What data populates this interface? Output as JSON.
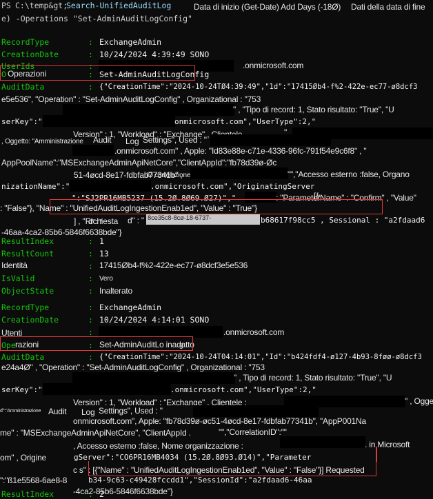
{
  "window": {
    "title": "Search-UnifiedAuditLog",
    "shell": "PowerShell",
    "background_color": "#0c0c0c",
    "label_color": "#16c60c",
    "text_color": "#cccccc",
    "annotation_color": "#e03a3a",
    "selection_background": "#c9c9c9"
  },
  "prompt": {
    "ps": "PS",
    "path": "C:\\temp&gt;",
    "command": "Search-UnifiedAuditLog",
    "continuation": "e) -Operations \"Set-AdminAuditLogConfig\""
  },
  "annotations": {
    "start_date": "Data di inizio (Get-Date) Add Days (-18Ø)",
    "end_date": "Dati della data di fine",
    "operations_label_1": "Operazioni",
    "operations_value_1": "Set-AdminAuditLogConfig",
    "operations_label_2": "Operazioni",
    "operations_value_2": "Set-AdminAuditLo inadatto",
    "operations_value_2_tail": "g"
  },
  "record1": {
    "fields": [
      {
        "label": "RecordType",
        "value": "ExchangeAdmin"
      },
      {
        "label": "CreationDate",
        "value": "10/24/2024 4:39:49 SONO"
      },
      {
        "label": "UserIds",
        "value": ""
      },
      {
        "label": "Operazioni",
        "value": "Set-AdminAuditLogConfig"
      },
      {
        "label": "AuditData",
        "value": ""
      }
    ],
    "userids_suffix": ".onmicrosoft.com",
    "audit_lines": {
      "l1": "{\"CreationTime\":\"2024-10-24TØ4:39:49\",\"1d\":\"17415Øb4-f%2-422e-ec77-ø8dcf3",
      "l2": "e5e536\", \"Operation\" : \"Set-AdminAuditLogConfig\" , Organizational : \"753",
      "l3": "\" , \"Tipo di record: 1, Stato risultato: \"True\", \"U",
      "l4a": "serKey\":\"",
      "l4b": "onmicrosoft.com\",\"UserType\":2,\"",
      "l5": "Version\" : 1, \"Workload\" : \"Exchange\" , Clientele .",
      "l5q": "\"",
      "l6a": ", Oggetto: \"Amministrazione",
      "l6b": "Audit",
      "l6c": "Log",
      "l6d": "Settings\", Used : \"",
      "l7a": ".onmicrosoft.com\" , Apple: \"Id83e88e-c71e-4336-96fc-791f54e9c6f8\" , \"",
      "l8": "AppPoolName\":\"MSExchangeAdminApiNetCore\",\"ClientAppId\":\"fb78d39ø-Øc",
      "l9a": "51-4øcd-8e17-fdbfab77341b\" ,",
      "l9b": "ID correlazione .",
      "l9c": "\"\",\"Accesso esterno :false, Organo",
      "l10a": "nizationName\":\"",
      "l10b": ".onmicrosoft.com\",\"OriginatingServer",
      "l11a": "\":\"SJ2PR16MB5237 (15.2Ø.8Ø69.Ø27)\",\"",
      "l11b": ": \"Parameter",
      "l11c": "[{",
      "l11d": "\"Name\" : \"Confirm\" , \"Value\"",
      "l12": ": \"False\"}, \"Name\" : \"UnifiedAuditLogIngestionEnab1ed\", \"Value\" : \"True\"}",
      "l13a": "] , \"Richiesta",
      "l13b": "d\" : \"",
      "l13sel": "8ce35c8-8cø-18-6737-",
      "l13c": "b68617f98cc5 , Sessional : \"a2fdaad6",
      "l14": "-46aa-4ca2-85b6-5846f6638bde\"}"
    },
    "result_fields": [
      {
        "label": "ResultIndex",
        "value": "1"
      },
      {
        "label": "ResultCount",
        "value": "13"
      },
      {
        "label": "Identità",
        "value": "17415Øb4-f%2-422e-ec77-ø8dcf3e5e536"
      },
      {
        "label": "IsValid",
        "value": "Vero"
      },
      {
        "label": "ObjectState",
        "value": "Inalterato"
      }
    ]
  },
  "record2": {
    "fields": [
      {
        "label": "RecordType",
        "value": "ExchangeAdmin"
      },
      {
        "label": "CreationDate",
        "value": "10/24/2024 4:14:01 SONO"
      },
      {
        "label": "Utenti",
        "value": ""
      },
      {
        "label": "Operazioni",
        "value": "Set-AdminAuditLo inadatto"
      },
      {
        "label": "AuditData",
        "value": ""
      }
    ],
    "users_suffix": ".onmicrosoft.com",
    "audit_lines": {
      "l1": "{\"CreationTime\":\"2024-10-24T04:14:01\",\"Id\":\"b424fdf4-ø127-4b93-8føø-ø8dcf3",
      "l2": "e24a4Ø\" , \"Operation\" : \"Set-AdminAuditLogConfig\" , Organizational : \"753",
      "l3": "\" , Tipo di record: 1, Stato risultato: \"True\", \"U",
      "l4a": "serKey\":\"",
      "l4b": ".onmicrosoft.com\",\"UserType\":2,\"",
      "l5": "Version\" : 1, \"Workload\" : \"Exchange\" , Clientele :",
      "l5tail": "\" , Oggetto",
      "l6a": "ď\":\"Amministrazione",
      "l6b": "Audit",
      "l6c": "Log",
      "l6d": "Settings\", Used : \"",
      "l7a": "onmicrosoft.com\", Apple: \"fb78d39ø-øc51-4øcd-8e17-fdbfab77341b\", \"AppP001Na",
      "l8a": "me\" : \"MSExchangeAdminApiNetCore\", \"ClientAppId .",
      "l8b": "\"\",\"CorrelationID\":\"\"",
      "l9a": ", Accesso esterno :false, Nome organizzazione :",
      "l9b": ". in Microsoft",
      "l10a": "om\" , Origine",
      "l10b": "gServer\":\"CO6PR16MB4034 (15.2Ø.8Ø93.Ø14)\",\"Parameter",
      "l11a": "c s\" : [{\"Name\" : \"UnifiedAuditLogIngestionEnab1ed\", \"Value\" : \"False\"}] Requested",
      "l12a": "\":\"ß1e5568-6ae8-8",
      "l12b": "b34-9c63-c49428fccdd1\",\"SessionId\":\"a2fdaad6-46aa",
      "l13": "-4ca2-85b6-5846f6638bde\"}"
    },
    "result_fields": [
      {
        "label": "ResultIndex",
        "value": "2"
      }
    ]
  }
}
